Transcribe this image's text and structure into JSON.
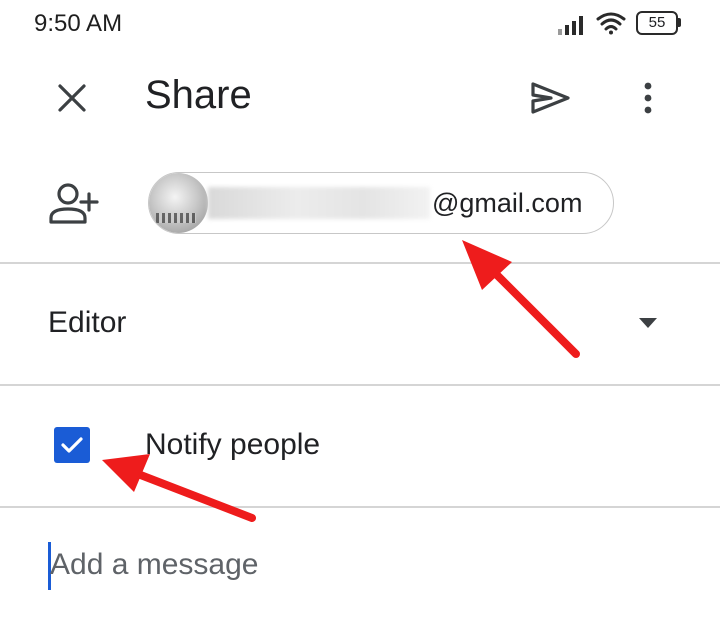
{
  "status_bar": {
    "time": "9:50 AM",
    "battery": "55",
    "icons": [
      "signal-icon",
      "wifi-icon",
      "battery-icon"
    ]
  },
  "app_bar": {
    "title": "Share",
    "icons": [
      "close-icon",
      "send-icon",
      "more-vert-icon"
    ]
  },
  "recipient": {
    "email_visible": "@gmail.com",
    "icon": "add-person-icon"
  },
  "role": {
    "selected": "Editor",
    "icon": "dropdown-caret-icon"
  },
  "notify": {
    "label": "Notify people",
    "checked": true
  },
  "message": {
    "placeholder": "Add a message"
  },
  "colors": {
    "accent": "#1a5cd6",
    "annotation_arrow": "#ee1c1c"
  }
}
